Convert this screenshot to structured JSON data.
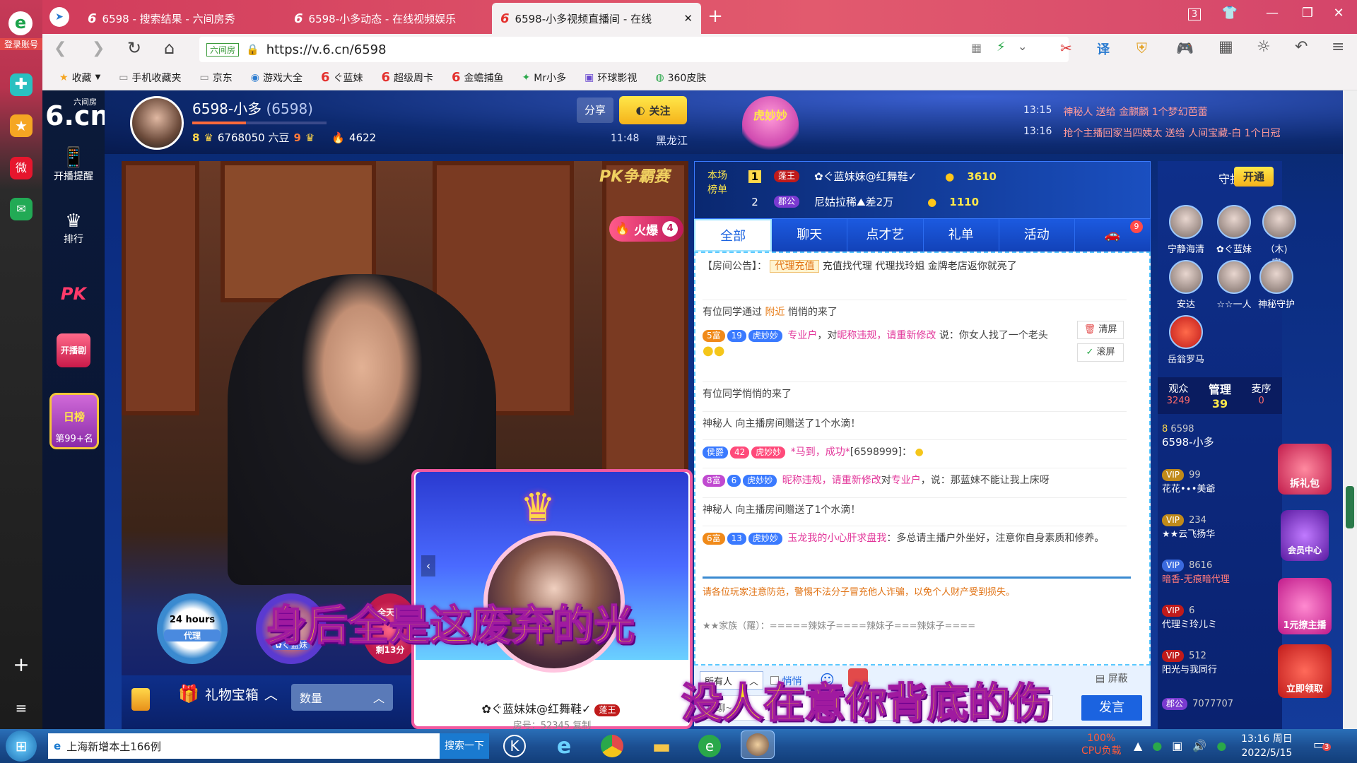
{
  "browser": {
    "tabs": [
      {
        "label": "6598 - 搜索结果 - 六间房秀"
      },
      {
        "label": "6598-小多动态 - 在线视频娱乐"
      },
      {
        "label": "6598-小多视频直播间 - 在线"
      }
    ],
    "new_tab": "+",
    "tab_count": "3",
    "url": "https://v.6.cn/6598",
    "site_tag": "六间房",
    "translate": "译",
    "bookmarks": [
      "收藏",
      "手机收藏夹",
      "京东",
      "游戏大全",
      "ぐ蓝妹",
      "超级周卡",
      "金蟾捕鱼",
      "Mr小多",
      "环球影视",
      "360皮肤"
    ]
  },
  "sidebar": {
    "login": "登录账号"
  },
  "leftnav": {
    "logo": "6.cn",
    "logo_sub": "六间房",
    "items": [
      {
        "label": "开播提醒"
      },
      {
        "label": "排行"
      },
      {
        "label": "PK"
      },
      {
        "label": "开播剧"
      }
    ],
    "daily_rank": "日榜",
    "daily_rank_pos": "第99+名"
  },
  "host": {
    "name": "6598-小多",
    "id": "(6598)",
    "level": "8",
    "beans": "6768050 六豆",
    "level2": "9",
    "fire": "4622",
    "share": "分享",
    "follow": "关注",
    "time": "11:48",
    "location": "黑龙江",
    "mascot": "虎妙妙"
  },
  "notices": [
    {
      "time": "13:15",
      "text": "神秘人 送给 金麒麟 1个梦幻芭蕾"
    },
    {
      "time": "13:16",
      "text": "抢个主播回家当四姨太 送给 人间宝藏-白 1个日冠"
    }
  ],
  "video": {
    "pk_label": "PK争霸赛",
    "hot_label": "火爆",
    "hot_num": "4",
    "badge1": "24 hours",
    "badge1_sub": "代理",
    "badge2": "✿ぐ蓝妹",
    "badge3_top": "全天候",
    "badge3_bottom": "剩13分"
  },
  "leaderboard": {
    "label": "本场榜单",
    "rows": [
      {
        "rank": "1",
        "tag": "蓬王",
        "name": "✿ぐ蓝妹妹@红舞鞋✓",
        "value": "3610"
      },
      {
        "rank": "2",
        "tag": "郡公",
        "name": "尼姑拉稀⛰差2万",
        "value": "1110"
      }
    ]
  },
  "chat_tabs": [
    "全部",
    "聊天",
    "点才艺",
    "礼单",
    "活动"
  ],
  "car_badge": "9",
  "chat": {
    "announcement_label": "【房间公告】：",
    "announcement_tag": "代理充值",
    "announcement_text": "充值找代理 代理找玲姐 金牌老店返你就亮了",
    "msgs": [
      {
        "pre": "有位同学通过",
        "link": "附近",
        "post": "悄悄的来了"
      },
      {
        "rich": "5富",
        "lvl": "19",
        "tag": "虎妙妙",
        "user": "专业户",
        "mid": "，对",
        "user2": "昵称违规，请重新修改",
        "post": " 说：你女人找了一个老头"
      },
      {
        "text": "有位同学悄悄的来了"
      },
      {
        "text": "神秘人 向主播房间赠送了1个水滴！"
      },
      {
        "rich": "侯爵",
        "lvl": "42",
        "tag": "虎妙妙",
        "user": "*马到，成功*",
        "post": "[6598999]："
      },
      {
        "rich": "8富",
        "lvl": "6",
        "tag": "虎妙妙",
        "user": "昵称违规，请重新修改",
        "mid": "对",
        "user2": "专业户",
        "post": "，说：那蓝妹不能让我上床呀"
      },
      {
        "text": "神秘人 向主播房间赠送了1个水滴！"
      },
      {
        "rich": "6富",
        "lvl": "13",
        "tag": "虎妙妙",
        "user": "玉龙我的小心肝求盘我",
        "post": "：多总请主播户外坐好，注意你自身素质和修养。"
      }
    ],
    "warning": "请各位玩家注意防范，警惕不法分子冒充他人诈骗，以免个人财产受到损失。",
    "family_line": "★★家族（羅）：=====辣妹子====辣妹子===辣妹子====",
    "clear": "清屏",
    "scroll": "滚屏"
  },
  "input": {
    "target": "所有人",
    "whisper": "悄悄",
    "shield": "屏蔽",
    "placeholder": "找聊~",
    "send": "发言"
  },
  "giftbar": {
    "treasure": "礼物宝箱",
    "qty": "数量"
  },
  "right": {
    "guard_label": "守护(0/7)",
    "open": "开通",
    "guards": [
      "宁静海清",
      "✿ぐ蓝妹",
      "（木)守",
      "安达",
      "☆☆一人",
      "神秘守护",
      "岳翁罗马"
    ],
    "stats": [
      {
        "label": "观众",
        "value": "3249"
      },
      {
        "label": "管理",
        "value": "39"
      },
      {
        "label": "麦序",
        "value": "0"
      }
    ],
    "audience": [
      {
        "lvl": "8",
        "num": "6598",
        "name": "6598-小多"
      },
      {
        "num": "99",
        "name": "花花•∙•美爺"
      },
      {
        "num": "234",
        "name": "★★云飞扬华"
      },
      {
        "num": "8616",
        "name": "暗香-无痕暗代理"
      },
      {
        "num": "6",
        "name": "代理ミ玲儿ミ"
      },
      {
        "num": "512",
        "name": "阳光与我同行"
      },
      {
        "num": "7077707",
        "name": "郡公"
      }
    ],
    "promos": [
      "拆礼包",
      "会员中心",
      "1元撩主播",
      "立即领取"
    ]
  },
  "pip": {
    "name": "✿ぐ蓝妹妹@红舞鞋✓",
    "tag": "蓬王",
    "room_no": "房号：52345",
    "copy": "复制"
  },
  "lyrics": {
    "line1": "身后全是这废弃的光",
    "line2": "没人在意你背底的伤"
  },
  "taskbar": {
    "search_text": "上海新增本土166例",
    "search_btn": "搜索一下",
    "cpu": "100%",
    "cpu_label": "CPU负载",
    "time": "13:16 周日",
    "date": "2022/5/15",
    "notif": "3"
  }
}
